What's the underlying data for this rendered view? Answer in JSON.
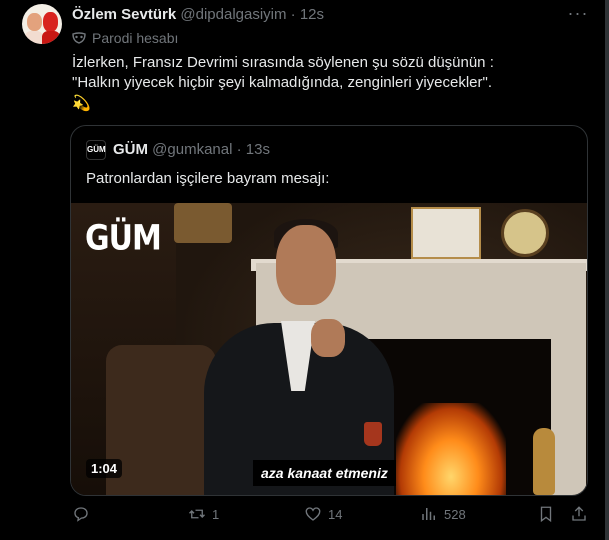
{
  "author": {
    "display_name": "Özlem Sevtürk",
    "handle": "@dipdalgasiyim",
    "separator": "·",
    "time": "12s",
    "label": "Parodi hesabı"
  },
  "tweet": {
    "line1": "İzlerken, Fransız Devrimi sırasında söylenen şu sözü düşünün :",
    "line2": "\"Halkın yiyecek hiçbir şeyi kalmadığında, zenginleri yiyecekler\".",
    "emoji": "💫"
  },
  "quoted": {
    "avatar_text": "GÜM",
    "display_name": "GÜM",
    "handle": "@gumkanal",
    "separator": "·",
    "time": "13s",
    "text": "Patronlardan işçilere bayram mesajı:",
    "video": {
      "logo": "GÜM",
      "duration": "1:04",
      "subtitle": "aza kanaat etmeniz"
    }
  },
  "actions": {
    "reply_count": "",
    "retweet_count": "1",
    "like_count": "14",
    "views_count": "528"
  },
  "colors": {
    "background": "#000000",
    "text": "#e7e9ea",
    "secondary": "#71767b",
    "border": "#2f3336"
  }
}
